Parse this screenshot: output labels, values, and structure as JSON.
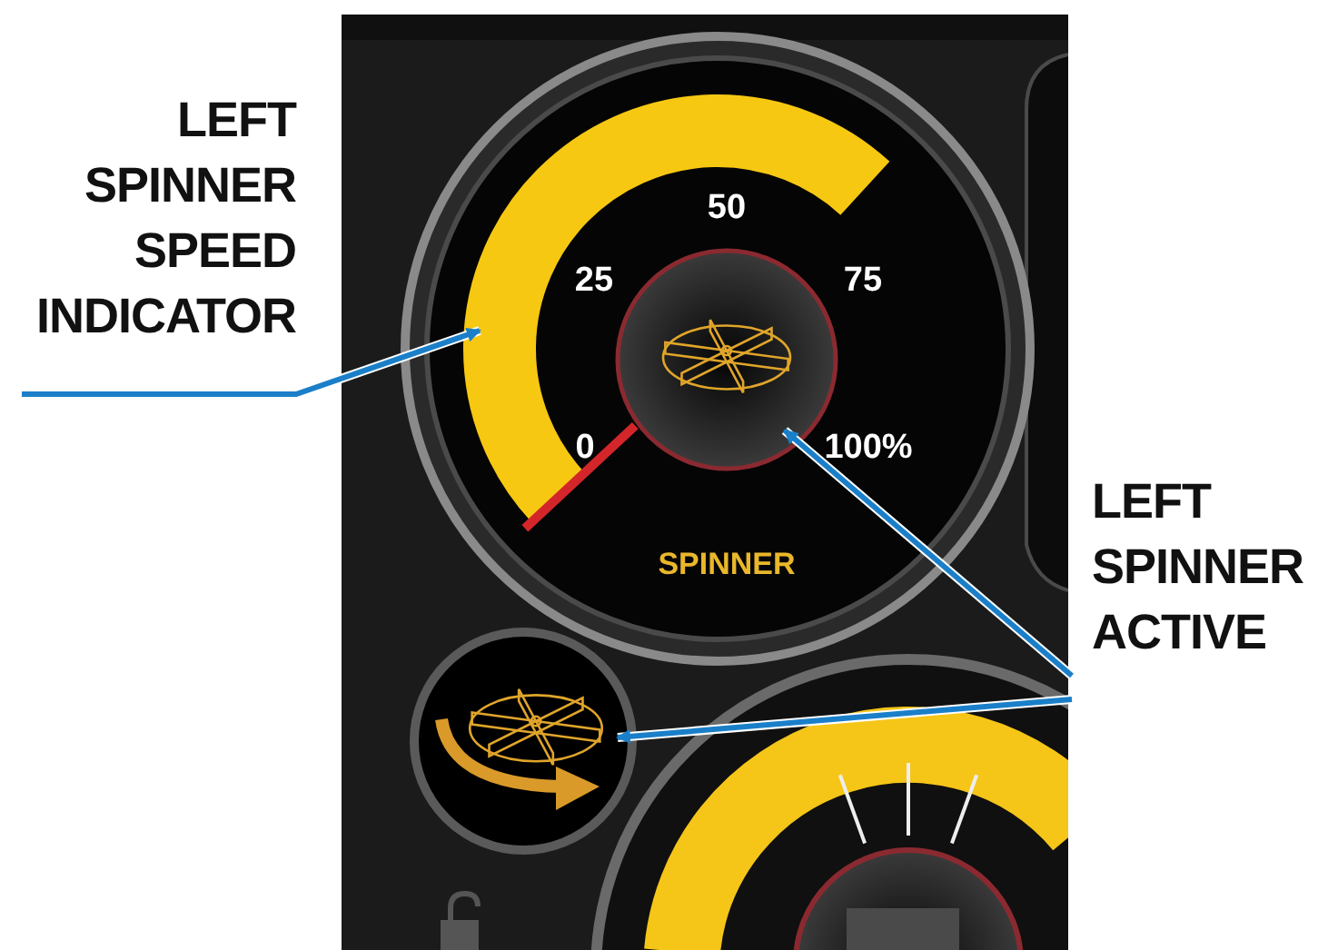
{
  "callouts": [
    {
      "text": "LEFT SPINNER SPEED INDICATOR",
      "kind": "left"
    },
    {
      "text": "LEFT SPINNER ACTIVE",
      "kind": "right"
    }
  ],
  "gauge": {
    "scale": [
      "0",
      "25",
      "50",
      "75",
      "100%"
    ],
    "label": "SPINNER",
    "level": 0.66
  },
  "left_spinner": {
    "active": true
  }
}
